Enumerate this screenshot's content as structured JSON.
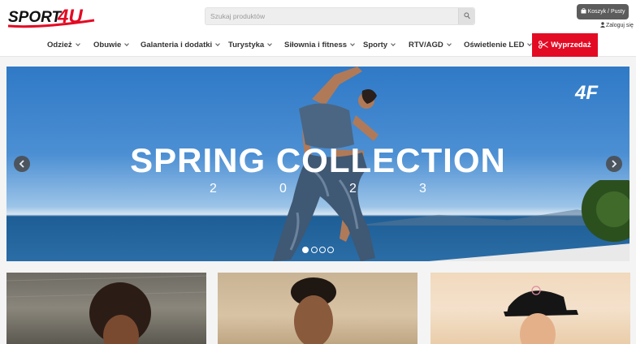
{
  "header": {
    "logo_text": "SPORT4U",
    "search": {
      "placeholder": "Szukaj produktów"
    },
    "cart": {
      "label": "Koszyk / Pusty"
    },
    "login": {
      "label": "Zaloguj się"
    }
  },
  "nav": {
    "items": [
      {
        "label": "Odzież"
      },
      {
        "label": "Obuwie"
      },
      {
        "label": "Galanteria i dodatki"
      },
      {
        "label": "Turystyka"
      },
      {
        "label": "Siłownia i fitness"
      },
      {
        "label": "Sporty"
      },
      {
        "label": "RTV/AGD"
      },
      {
        "label": "Oświetlenie LED"
      }
    ],
    "sale_label": "Wyprzedaż"
  },
  "hero": {
    "title": "SPRING COLLECTION",
    "year": [
      "2",
      "0",
      "2",
      "3"
    ],
    "brand": "4F",
    "slides_total": 4,
    "active_slide": 1
  },
  "colors": {
    "accent": "#e30b24",
    "dark_button": "#5c5c5c"
  },
  "icons": {
    "search": "search-icon",
    "cart": "bag-icon",
    "user": "user-icon",
    "sale": "scissors-icon",
    "prev": "chevron-left-icon",
    "next": "chevron-right-icon"
  }
}
